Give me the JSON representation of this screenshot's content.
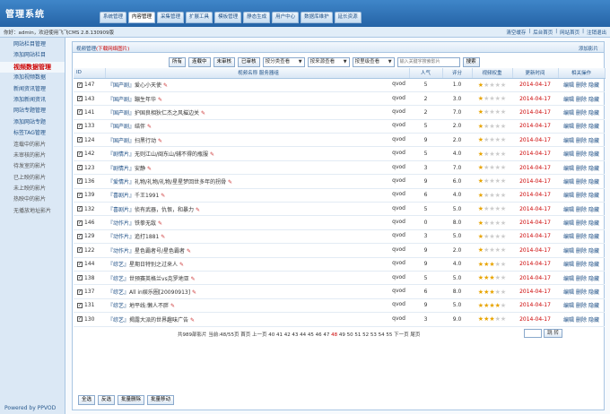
{
  "app": {
    "logo": "管理系统"
  },
  "nav": [
    "系统管理",
    "内容管理",
    "采集管理",
    "扩展工具",
    "模板管理",
    "静态生成",
    "用户中心",
    "数据库维护",
    "延长资源"
  ],
  "info": {
    "welcome": "你好：admin，欢迎使用飞飞CMS 2.8.130909版",
    "links": [
      "清空缓存",
      "后台首页",
      "网站首页",
      "注销退出"
    ]
  },
  "sidebar": {
    "items": [
      "网站栏目管理",
      "添加网站栏目",
      "视频数据管理",
      "添加视频数据",
      "新闻资讯管理",
      "添加新闻资讯",
      "网站专题管理",
      "添加网站专题",
      "标签TAG管理",
      "连载中的影片",
      "未审核的影片",
      "待发室的影片",
      "已上映的影片",
      "未上映的影片",
      "热映中的影片",
      "无播放地址影片"
    ],
    "active_index": 2,
    "powered": "Powered by PPVOD"
  },
  "panel": {
    "title": "视频管理",
    "subtitle": "(下载网络图片)",
    "add_link": "添加影片"
  },
  "filters": {
    "buttons": [
      "所有",
      "连载中",
      "未审核",
      "已审核"
    ],
    "selects": [
      "按分类查看",
      "按来源查看",
      "按里级查看"
    ],
    "search_placeholder": "输入关键字搜索影片",
    "search_button": "搜索"
  },
  "table": {
    "headers": [
      "ID",
      "视频名称  服务器组",
      "人气",
      "评分",
      "视频权重",
      "更新时间",
      "相关操作"
    ],
    "actions": [
      "编辑",
      "删除",
      "隐藏"
    ],
    "rows": [
      {
        "id": "147",
        "cat": "『国产剧』",
        "name": "爱心小天使",
        "src": "qvod",
        "pop": "5",
        "score": "1.0",
        "stars": 1,
        "date": "2014-04-17"
      },
      {
        "id": "143",
        "cat": "『国产剧』",
        "name": "蹦生年华",
        "src": "qvod",
        "pop": "2",
        "score": "3.0",
        "stars": 1,
        "date": "2014-04-17"
      },
      {
        "id": "141",
        "cat": "『国产剧』",
        "name": "护国良相狄仁杰之风摧边关",
        "src": "qvod",
        "pop": "2",
        "score": "7.0",
        "stars": 1,
        "date": "2014-04-17"
      },
      {
        "id": "133",
        "cat": "『国产剧』",
        "name": "结伴",
        "src": "qvod",
        "pop": "5",
        "score": "2.0",
        "stars": 1,
        "date": "2014-04-17"
      },
      {
        "id": "124",
        "cat": "『国产剧』",
        "name": "扫黑行动",
        "src": "qvod",
        "pop": "9",
        "score": "2.0",
        "stars": 1,
        "date": "2014-04-17"
      },
      {
        "id": "142",
        "cat": "『剧情片』",
        "name": "无则江山/闽东山/辅不得的瓶服",
        "src": "qvod",
        "pop": "5",
        "score": "4.0",
        "stars": 1,
        "date": "2014-04-17"
      },
      {
        "id": "123",
        "cat": "『剧情片』",
        "name": "安静",
        "src": "qvod",
        "pop": "3",
        "score": "7.0",
        "stars": 1,
        "date": "2014-04-17"
      },
      {
        "id": "136",
        "cat": "『爱情片』",
        "name": "礼物/礼物/礼物/星星梦回世多年的拐骨",
        "src": "qvod",
        "pop": "9",
        "score": "6.0",
        "stars": 1,
        "date": "2014-04-17"
      },
      {
        "id": "139",
        "cat": "『喜剧片』",
        "name": "千王1991",
        "src": "qvod",
        "pop": "6",
        "score": "4.0",
        "stars": 1,
        "date": "2014-04-17"
      },
      {
        "id": "132",
        "cat": "『喜剧片』",
        "name": "侦有武器，仇恨，和暴力",
        "src": "qvod",
        "pop": "5",
        "score": "5.0",
        "stars": 1,
        "date": "2014-04-17"
      },
      {
        "id": "146",
        "cat": "『动作片』",
        "name": "铁拳无敌",
        "src": "qvod",
        "pop": "0",
        "score": "8.0",
        "stars": 1,
        "date": "2014-04-17"
      },
      {
        "id": "129",
        "cat": "『动作片』",
        "name": "追打1881",
        "src": "qvod",
        "pop": "3",
        "score": "5.0",
        "stars": 1,
        "date": "2014-04-17"
      },
      {
        "id": "122",
        "cat": "『动作片』",
        "name": "星色霸者号/星色霸者",
        "src": "qvod",
        "pop": "9",
        "score": "2.0",
        "stars": 1,
        "date": "2014-04-17"
      },
      {
        "id": "144",
        "cat": "『综艺』",
        "name": "星期日特别之过来人",
        "src": "qvod",
        "pop": "9",
        "score": "4.0",
        "stars": 3,
        "date": "2014-04-17"
      },
      {
        "id": "138",
        "cat": "『综艺』",
        "name": "世预赛英格兰vs克罗地亚",
        "src": "qvod",
        "pop": "5",
        "score": "5.0",
        "stars": 3,
        "date": "2014-04-17"
      },
      {
        "id": "137",
        "cat": "『综艺』",
        "name": "All in娱乐圈[20090913]",
        "src": "qvod",
        "pop": "6",
        "score": "8.0",
        "stars": 3,
        "date": "2014-04-17"
      },
      {
        "id": "131",
        "cat": "『综艺』",
        "name": "地平线:懒人不胖",
        "src": "qvod",
        "pop": "9",
        "score": "5.0",
        "stars": 4,
        "date": "2014-04-17"
      },
      {
        "id": "130",
        "cat": "『综艺』",
        "name": "揭露大派的世界趣味广告",
        "src": "qvod",
        "pop": "3",
        "score": "9.0",
        "stars": 3,
        "date": "2014-04-17"
      }
    ]
  },
  "pager": {
    "prefix": "共989部影片 当前:48/55页 首页 上一页 40 41 42 43 44 45 46 47 ",
    "current": "48",
    "suffix": " 49 50 51 52 53 54 55 下一页 尾页",
    "jump": "跳 转"
  },
  "bottom_buttons": [
    "全选",
    "反选",
    "批量删除",
    "批量移动"
  ],
  "colors": {
    "accent": "#2563a6",
    "date": "#cc0000",
    "star": "#e8a400"
  }
}
